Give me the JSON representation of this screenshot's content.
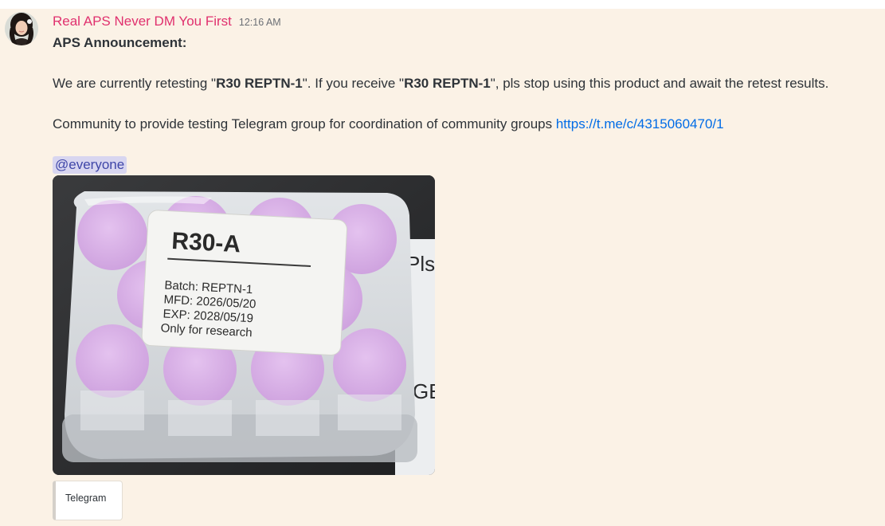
{
  "message": {
    "author": "Real APS Never DM You First",
    "timestamp": "12:16 AM",
    "heading": "APS Announcement:",
    "line1": {
      "part1": "We are currently retesting \"",
      "bold1": "R30 REPTN-1",
      "part2": "\". If you receive \"",
      "bold2": "R30 REPTN-1",
      "part3": "\", pls stop using this product and await the retest results."
    },
    "line2": {
      "text": "Community to provide testing Telegram group for coordination of community groups ",
      "link": "https://t.me/c/4315060470/1"
    },
    "mention": "@everyone"
  },
  "attachment": {
    "label": {
      "title": "R30-A",
      "batch": "Batch:  REPTN-1",
      "mfd": "MFD:  2026/05/20",
      "exp": "EXP:   2028/05/19",
      "note": "Only for research"
    },
    "background_box_text": "Pls",
    "background_box_text2": "GE",
    "vial_cap_color": "#dcb4e8",
    "box_color": "#dadde0"
  },
  "embed": {
    "provider": "Telegram"
  },
  "colors": {
    "background": "#fbf2e6",
    "username": "#e0306e",
    "link": "#006ce7",
    "mention_bg": "#d8d6f0",
    "mention_text": "#3f46a8"
  }
}
